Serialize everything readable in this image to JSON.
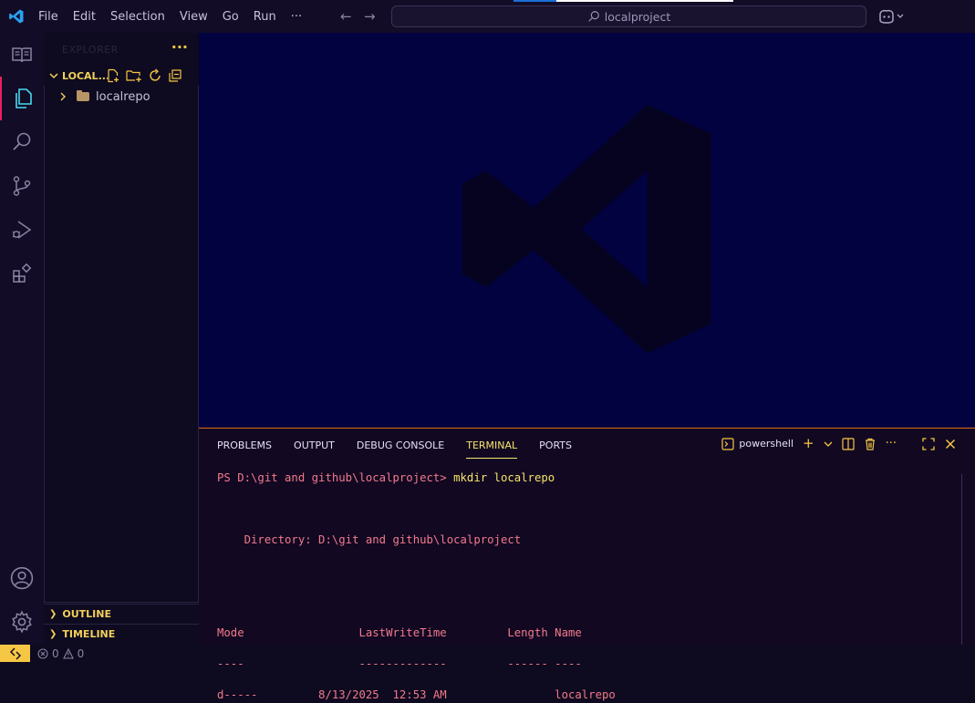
{
  "titlebar": {
    "menu": [
      "File",
      "Edit",
      "Selection",
      "View",
      "Go",
      "Run",
      "···"
    ],
    "search_text": "localproject"
  },
  "activitybar": {
    "icons": [
      "explorer-icon",
      "copy-files-icon",
      "search-icon",
      "source-control-icon",
      "run-debug-icon",
      "extensions-icon",
      "account-icon",
      "settings-gear-icon"
    ]
  },
  "sidebar": {
    "title": "EXPLORER",
    "menu_dots": "···",
    "section_name": "LOCAL...",
    "tree": [
      {
        "label": "localrepo",
        "type": "folder"
      }
    ],
    "outline_label": "OUTLINE",
    "timeline_label": "TIMELINE"
  },
  "panel": {
    "tabs": [
      "PROBLEMS",
      "OUTPUT",
      "DEBUG CONSOLE",
      "TERMINAL",
      "PORTS"
    ],
    "active_tab": "TERMINAL",
    "shell_name": "powershell",
    "more": "···",
    "terminal": {
      "prompt": "PS D:\\git and github\\localproject> ",
      "command": "mkdir localrepo",
      "directory_line": "    Directory: D:\\git and github\\localproject",
      "header_line": "Mode                 LastWriteTime         Length Name",
      "separator_line": "----                 -------------         ------ ----",
      "entry_line": "d-----         8/13/2025  12:53 AM                localrepo"
    }
  },
  "statusbar": {
    "errors": "0",
    "warnings": "0"
  },
  "colors": {
    "accent_yellow": "#f6c744",
    "active_indicator": "#e91e63",
    "panel_border": "#e06b14",
    "terminal_text": "#f27a8b",
    "editor_bg": "#030240"
  }
}
